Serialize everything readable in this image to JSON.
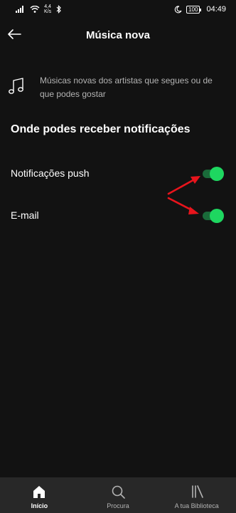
{
  "status": {
    "net_speed_top": "4,4",
    "net_speed_bottom": "K/s",
    "battery": "100",
    "time": "04:49"
  },
  "header": {
    "title": "Música nova",
    "back_icon": "arrow-left-icon"
  },
  "description": {
    "icon": "music-note-icon",
    "text": "Músicas novas dos artistas que segues ou de que podes gostar"
  },
  "section": {
    "heading": "Onde podes receber notificações"
  },
  "settings": [
    {
      "label": "Notificações push",
      "enabled": true
    },
    {
      "label": "E-mail",
      "enabled": true
    }
  ],
  "bottom_nav": [
    {
      "label": "Início",
      "icon": "home-icon",
      "active": true
    },
    {
      "label": "Procura",
      "icon": "search-icon",
      "active": false
    },
    {
      "label": "A tua Biblioteca",
      "icon": "library-icon",
      "active": false
    }
  ],
  "colors": {
    "background": "#121212",
    "accent": "#1ed760",
    "annotation": "#e8141c",
    "nav_background": "#282828"
  }
}
